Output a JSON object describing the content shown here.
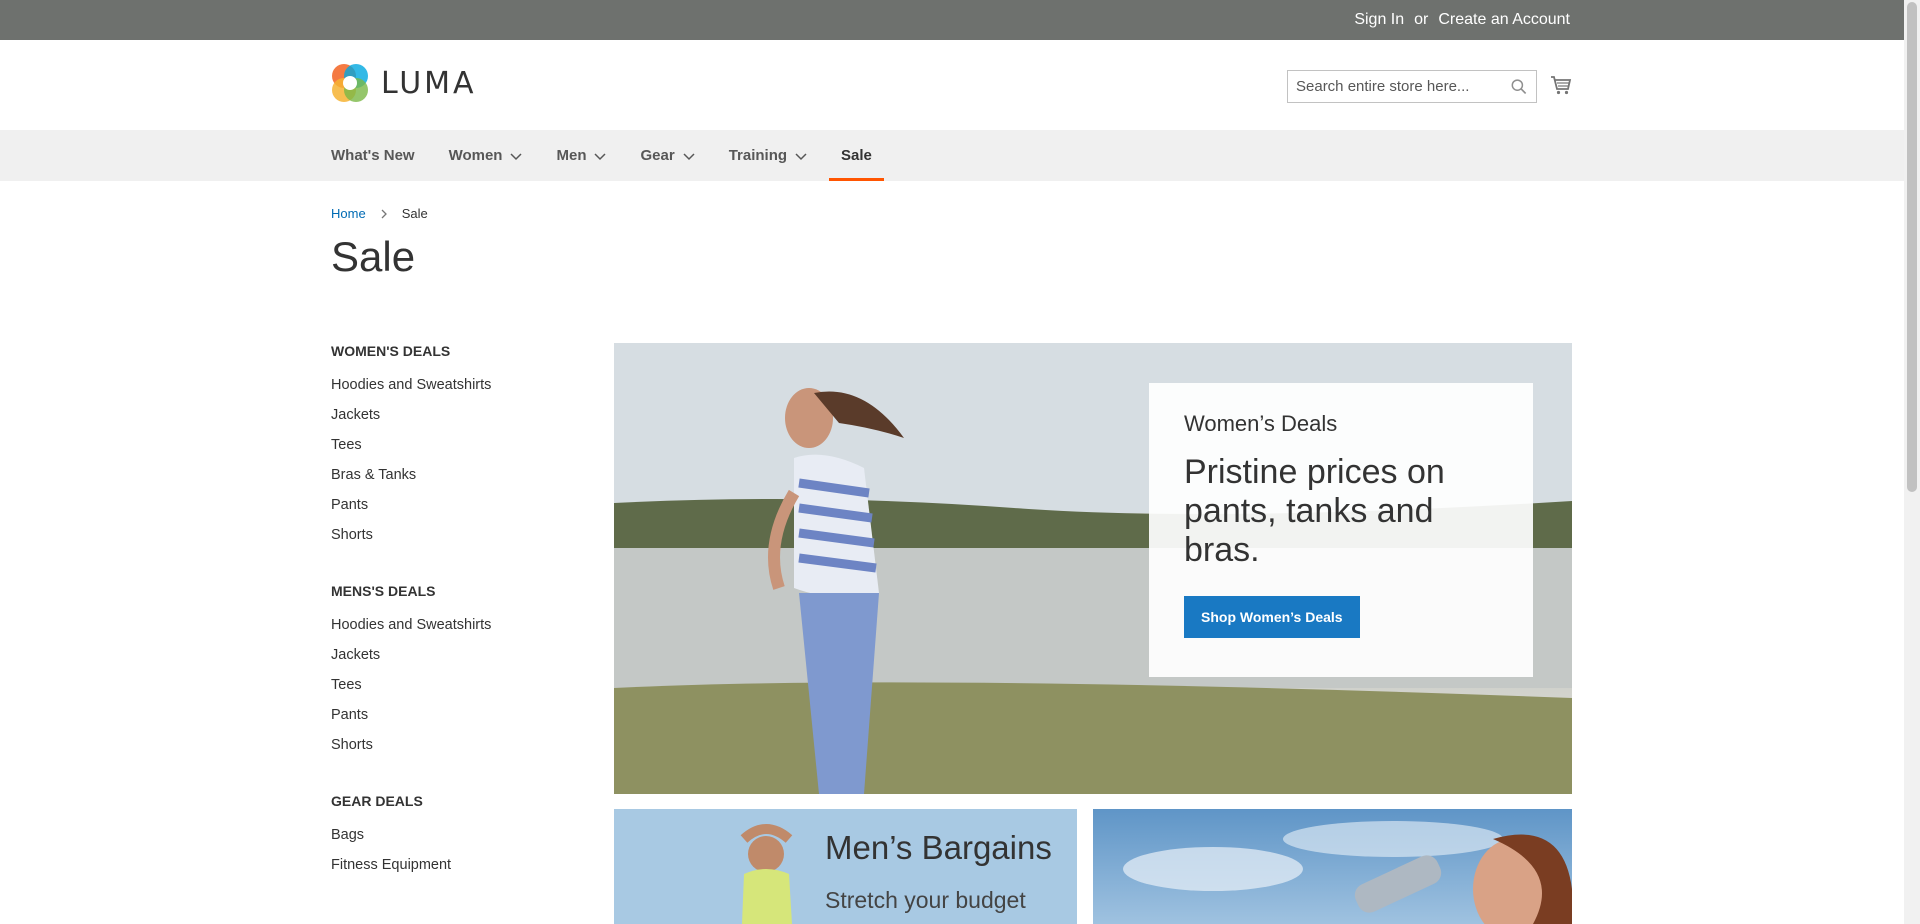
{
  "topbar": {
    "sign_in": "Sign In",
    "separator": "or",
    "create_account": "Create an Account"
  },
  "header": {
    "logo_text": "LUMA",
    "search_placeholder": "Search entire store here...",
    "icons": {
      "search": "search-icon",
      "cart": "cart-icon"
    }
  },
  "nav": {
    "items": [
      {
        "label": "What's New",
        "has_menu": false
      },
      {
        "label": "Women",
        "has_menu": true
      },
      {
        "label": "Men",
        "has_menu": true
      },
      {
        "label": "Gear",
        "has_menu": true
      },
      {
        "label": "Training",
        "has_menu": true
      },
      {
        "label": "Sale",
        "has_menu": false,
        "active": true
      }
    ]
  },
  "breadcrumb": {
    "home": "Home",
    "current": "Sale"
  },
  "page_title": "Sale",
  "sidebar": {
    "groups": [
      {
        "title": "WOMEN'S DEALS",
        "items": [
          "Hoodies and Sweatshirts",
          "Jackets",
          "Tees",
          "Bras & Tanks",
          "Pants",
          "Shorts"
        ]
      },
      {
        "title": "MENS'S DEALS",
        "items": [
          "Hoodies and Sweatshirts",
          "Jackets",
          "Tees",
          "Pants",
          "Shorts"
        ]
      },
      {
        "title": "GEAR DEALS",
        "items": [
          "Bags",
          "Fitness Equipment"
        ]
      }
    ]
  },
  "hero": {
    "kicker": "Women’s Deals",
    "headline": "Pristine prices on pants, tanks and bras.",
    "button": "Shop Women’s Deals"
  },
  "tiles": {
    "left_title": "Men’s Bargains",
    "left_sub": "Stretch your budget"
  },
  "colors": {
    "topbar": "#6e716e",
    "nav_bg": "#f0f0f0",
    "active_underline": "#ff5501",
    "link": "#006bb4",
    "button": "#1979c3"
  }
}
